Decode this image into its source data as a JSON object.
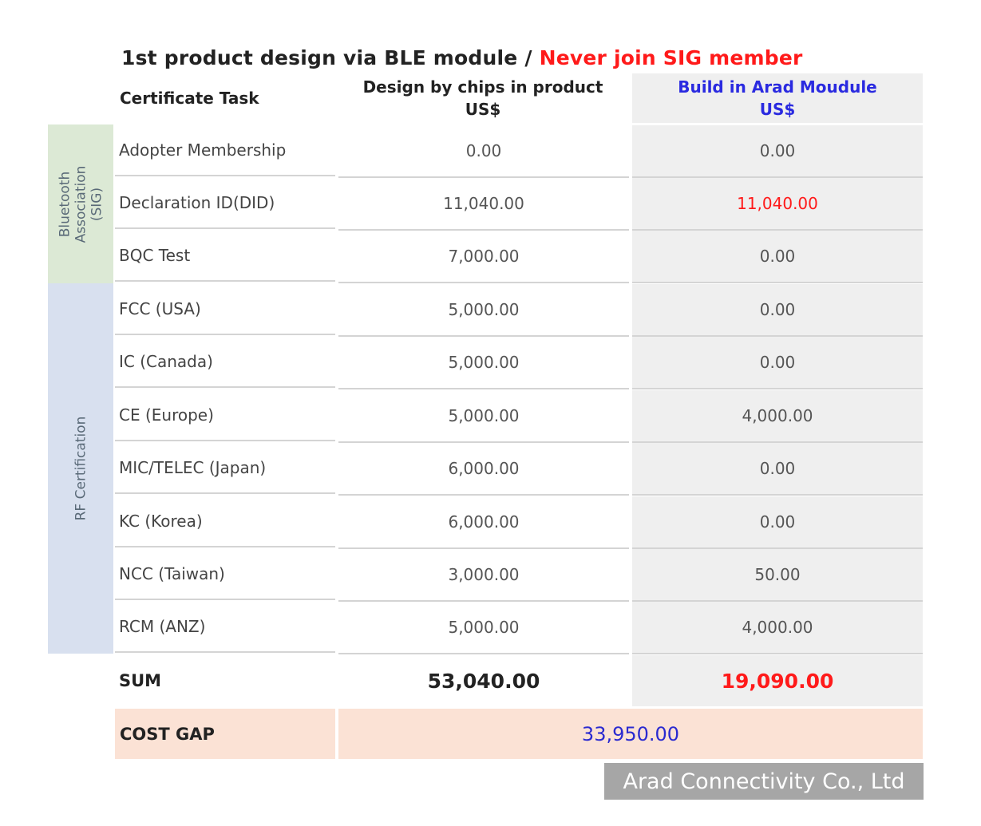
{
  "title": {
    "main": "1st product design via BLE module",
    "separator": "/",
    "highlight": "Never join SIG member"
  },
  "headers": {
    "task": "Certificate Task",
    "chip_line1": "Design by chips in product",
    "chip_line2": "US$",
    "arad_line1": "Build in Arad Moudule",
    "arad_line2": "US$"
  },
  "groups": {
    "bluetooth": "Bluetooth Association (SIG)",
    "rf": "RF Certification"
  },
  "rows": [
    {
      "task": "Adopter Membership",
      "chip": "0.00",
      "arad": "0.00"
    },
    {
      "task": "Declaration ID(DID)",
      "chip": "11,040.00",
      "arad": "11,040.00"
    },
    {
      "task": "BQC Test",
      "chip": "7,000.00",
      "arad": "0.00"
    },
    {
      "task": "FCC (USA)",
      "chip": "5,000.00",
      "arad": "0.00"
    },
    {
      "task": "IC (Canada)",
      "chip": "5,000.00",
      "arad": "0.00"
    },
    {
      "task": "CE (Europe)",
      "chip": "5,000.00",
      "arad": "4,000.00"
    },
    {
      "task": "MIC/TELEC (Japan)",
      "chip": "6,000.00",
      "arad": "0.00"
    },
    {
      "task": "KC (Korea)",
      "chip": "6,000.00",
      "arad": "0.00"
    },
    {
      "task": "NCC (Taiwan)",
      "chip": "3,000.00",
      "arad": "50.00"
    },
    {
      "task": "RCM (ANZ)",
      "chip": "5,000.00",
      "arad": "4,000.00"
    }
  ],
  "sum": {
    "label": "SUM",
    "chip": "53,040.00",
    "arad": "19,090.00"
  },
  "cost_gap": {
    "label": "COST GAP",
    "value": "33,950.00"
  },
  "footer": "Arad Connectivity Co., Ltd",
  "colors": {
    "highlight_red": "#ff1a1a",
    "arad_blue": "#2a2ae0",
    "bluetooth_group_bg": "#dce9d5",
    "rf_group_bg": "#d8e0ef",
    "cost_gap_bg": "#fbe2d5"
  }
}
